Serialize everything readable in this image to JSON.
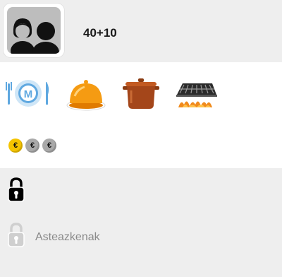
{
  "header": {
    "avatar_icon": "people-icon",
    "capacity": "40+10"
  },
  "services": [
    {
      "name": "menu-plate-icon"
    },
    {
      "name": "food-dish-icon"
    },
    {
      "name": "cooking-pot-icon"
    },
    {
      "name": "grill-icon"
    }
  ],
  "price": {
    "symbol": "€",
    "level": 1,
    "max": 3
  },
  "schedule": {
    "rows": [
      {
        "icon": "lock-closed-icon",
        "label": ""
      },
      {
        "icon": "lock-open-icon",
        "label": "Asteazkenak"
      }
    ]
  },
  "colors": {
    "header_bg": "#eeeeee",
    "coin_active": "#f5c400",
    "coin_inactive": "#a9a9a9",
    "muted_text": "#8a8a8a"
  }
}
